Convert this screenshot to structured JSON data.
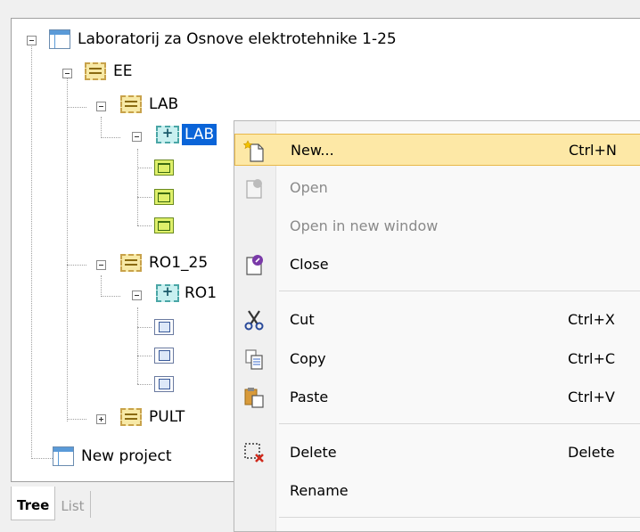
{
  "tree": {
    "root": {
      "label": "Laboratorij za Osnove elektrotehnike 1-25"
    },
    "ee": {
      "label": "EE"
    },
    "lab": {
      "label": "LAB"
    },
    "lab_child": {
      "label": "LAB"
    },
    "ro1_25": {
      "label": "RO1_25"
    },
    "ro1_child": {
      "label": "RO1"
    },
    "pult": {
      "label": "PULT"
    },
    "new_project": {
      "label": "New project"
    }
  },
  "tabs": [
    {
      "label": "Tree",
      "active": true
    },
    {
      "label": "List",
      "active": false
    }
  ],
  "context_menu": {
    "items": [
      {
        "label": "New...",
        "shortcut": "Ctrl+N",
        "icon": "new-icon",
        "enabled": true,
        "highlighted": true
      },
      {
        "label": "Open",
        "shortcut": "",
        "icon": "open-icon",
        "enabled": false
      },
      {
        "label": "Open in new window",
        "shortcut": "",
        "icon": "",
        "enabled": false
      },
      {
        "label": "Close",
        "shortcut": "",
        "icon": "close-icon",
        "enabled": true
      },
      {
        "label": "Cut",
        "shortcut": "Ctrl+X",
        "icon": "scissors-icon",
        "enabled": true
      },
      {
        "label": "Copy",
        "shortcut": "Ctrl+C",
        "icon": "copy-icon",
        "enabled": true
      },
      {
        "label": "Paste",
        "shortcut": "Ctrl+V",
        "icon": "paste-icon",
        "enabled": true
      },
      {
        "label": "Delete",
        "shortcut": "Delete",
        "icon": "delete-icon",
        "enabled": true
      },
      {
        "label": "Rename",
        "shortcut": "",
        "icon": "",
        "enabled": true
      }
    ]
  },
  "colors": {
    "selection": "#0a64d8",
    "menu_highlight": "#fde8a6",
    "menu_highlight_border": "#e8b84a"
  }
}
